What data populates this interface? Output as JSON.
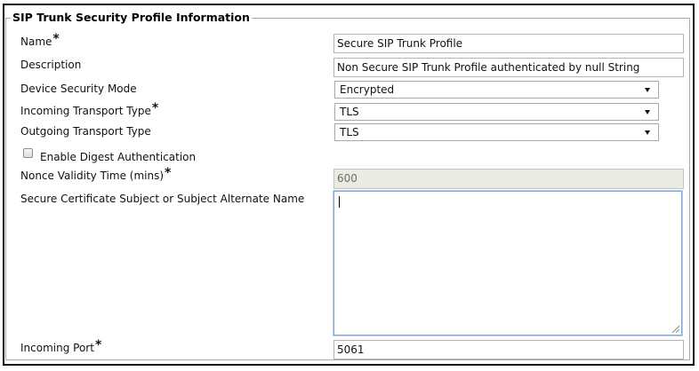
{
  "section": {
    "title": "SIP Trunk Security Profile Information"
  },
  "required_marker": "*",
  "fields": {
    "name": {
      "label": "Name",
      "value": "Secure SIP Trunk Profile"
    },
    "description": {
      "label": "Description",
      "value": "Non Secure SIP Trunk Profile authenticated by null String"
    },
    "device_security_mode": {
      "label": "Device Security Mode",
      "value": "Encrypted"
    },
    "incoming_transport_type": {
      "label": "Incoming Transport Type",
      "value": "TLS"
    },
    "outgoing_transport_type": {
      "label": "Outgoing Transport Type",
      "value": "TLS"
    },
    "enable_digest_authentication": {
      "label": "Enable Digest Authentication",
      "checked": false
    },
    "nonce_validity_time": {
      "label": "Nonce Validity Time (mins)",
      "value": "600",
      "disabled": true
    },
    "secure_certificate_subject": {
      "label": "Secure Certificate Subject or Subject Alternate Name",
      "value": ""
    },
    "incoming_port": {
      "label": "Incoming Port",
      "value": "5061"
    }
  },
  "icons": {
    "dropdown": "chevron-down-icon",
    "checkbox": "checkbox-unchecked",
    "resize": "resize-grip-icon"
  },
  "colors": {
    "focus_border": "#7fa7d6",
    "disabled_bg": "#ebebe4",
    "fieldset_border": "#a8a8a8"
  }
}
